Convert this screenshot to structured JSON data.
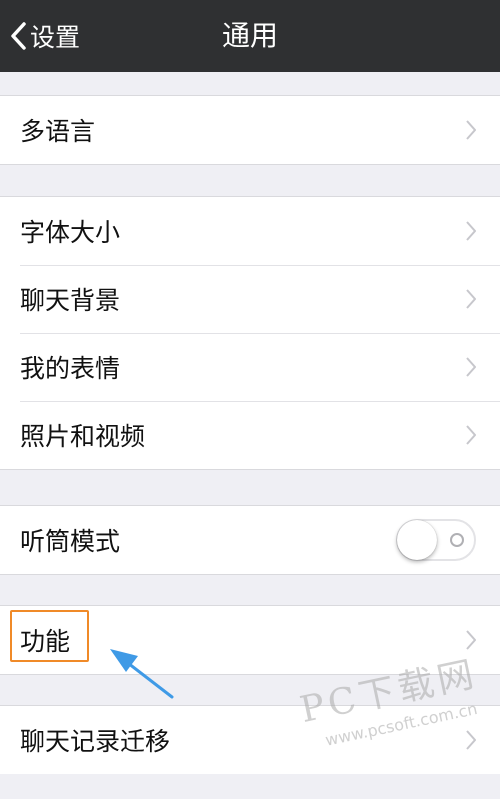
{
  "navbar": {
    "back_label": "设置",
    "title": "通用"
  },
  "sections": {
    "language": {
      "label": "多语言"
    },
    "display": {
      "items": [
        {
          "label": "字体大小"
        },
        {
          "label": "聊天背景"
        },
        {
          "label": "我的表情"
        },
        {
          "label": "照片和视频"
        }
      ]
    },
    "earpiece": {
      "label": "听筒模式",
      "toggle_on": false
    },
    "features": {
      "label": "功能"
    },
    "migration": {
      "label": "聊天记录迁移"
    }
  },
  "watermark": {
    "title": "PC下载网",
    "url": "www.pcsoft.com.cn"
  },
  "colors": {
    "navbar": "#2f3032",
    "background": "#efeff4",
    "highlight": "#f08a28",
    "arrow": "#3f9ae6"
  },
  "icons": {
    "back": "chevron-left-icon",
    "row": "chevron-right-icon"
  }
}
